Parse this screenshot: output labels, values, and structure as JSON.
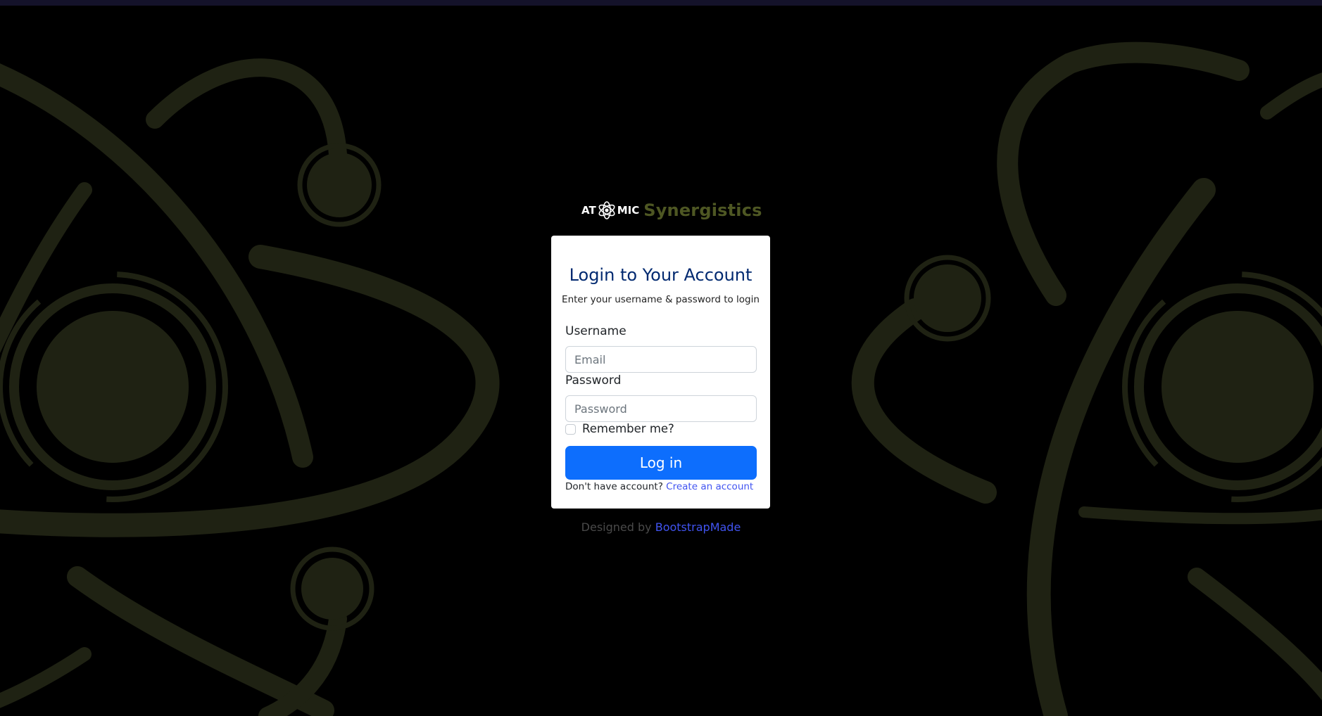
{
  "brand": {
    "atomic_prefix": "AT",
    "atomic_suffix": "MIC",
    "name": "Synergistics",
    "accent_color": "#4e5723"
  },
  "login_card": {
    "title": "Login to Your Account",
    "subtitle": "Enter your username & password to login",
    "username_label": "Username",
    "username_placeholder": "Email",
    "username_value": "",
    "password_label": "Password",
    "password_placeholder": "Password",
    "password_value": "",
    "remember_label": "Remember me?",
    "remember_checked": false,
    "login_button_label": "Log in",
    "signup_prompt": "Don't have account?",
    "signup_link_label": "Create an account",
    "button_color": "#0d6efd"
  },
  "footer": {
    "credits_text": "Designed by",
    "credits_link_label": "BootstrapMade"
  },
  "background": {
    "color": "#000000",
    "pattern": "atom-icon",
    "pattern_color": "#1f2213"
  }
}
